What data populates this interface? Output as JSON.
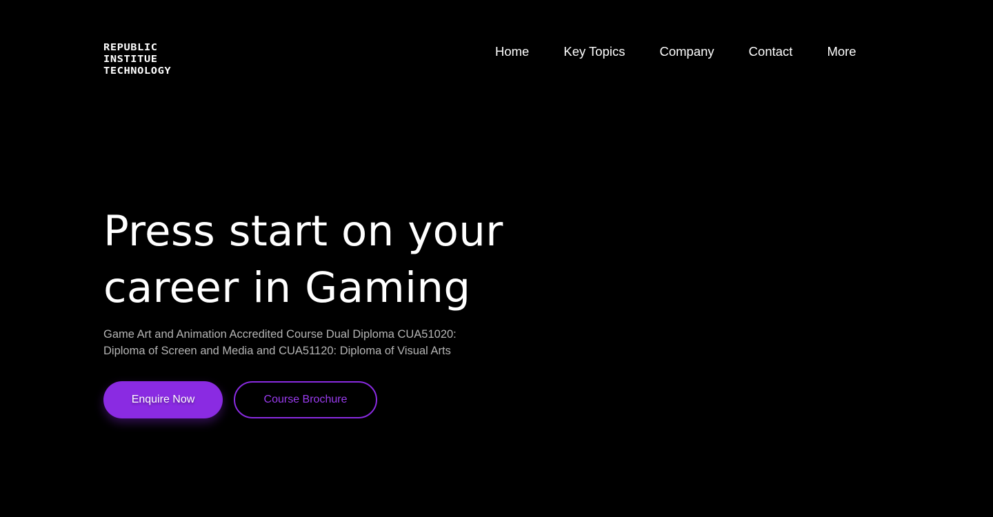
{
  "logo": {
    "line1": "REPUBLIC",
    "line2": "INSTITUE",
    "line3": "TECHNOLOGY"
  },
  "nav": {
    "items": [
      {
        "label": "Home"
      },
      {
        "label": "Key Topics"
      },
      {
        "label": "Company"
      },
      {
        "label": "Contact"
      },
      {
        "label": "More"
      }
    ]
  },
  "hero": {
    "title_line1": "Press start on your",
    "title_line2": "career in Gaming",
    "subtitle_line1": "Game Art and Animation Accredited Course Dual Diploma CUA51020:",
    "subtitle_line2": "Diploma of Screen and Media and CUA51120: Diploma of Visual Arts",
    "primary_button": "Enquire Now",
    "secondary_button": "Course Brochure"
  },
  "colors": {
    "background": "#000000",
    "accent": "#8a2be2",
    "text": "#ffffff",
    "muted_text": "#b5b5b5"
  }
}
